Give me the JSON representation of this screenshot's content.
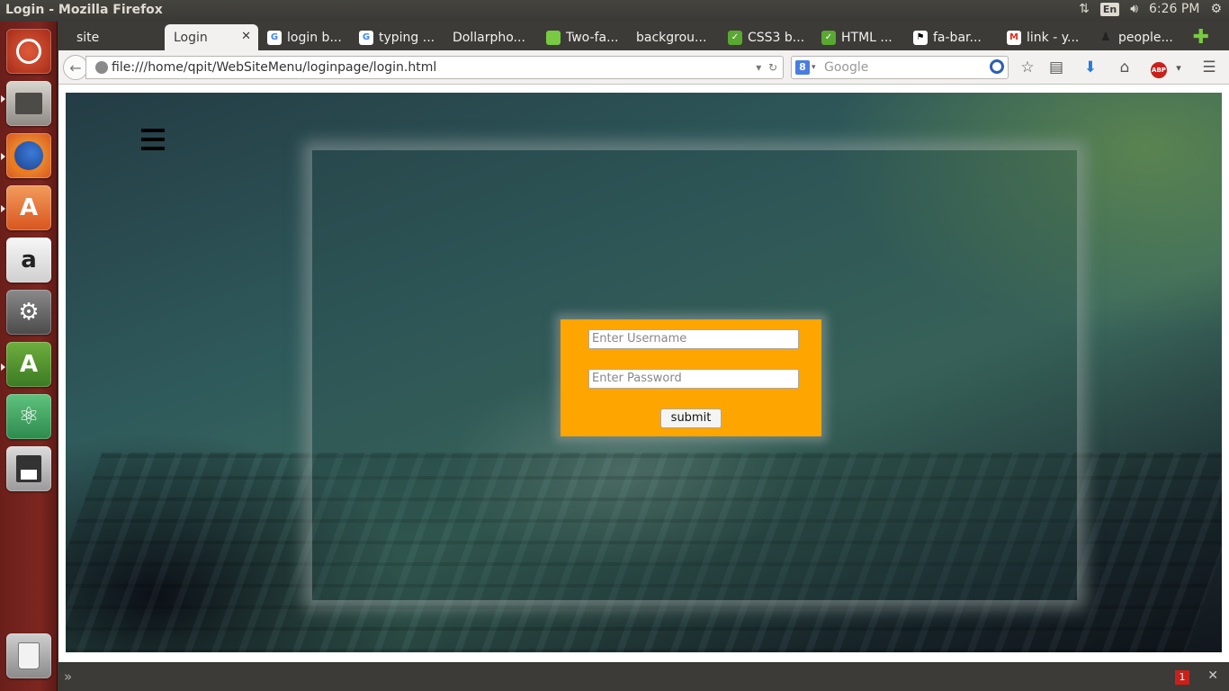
{
  "window": {
    "title": "Login - Mozilla Firefox"
  },
  "system": {
    "keyboard_layout": "En",
    "time": "6:26 PM"
  },
  "tabs": [
    {
      "label": "site",
      "icon": "none"
    },
    {
      "label": "Login",
      "icon": "none",
      "active": true
    },
    {
      "label": "login b...",
      "icon": "google-icon"
    },
    {
      "label": "typing ...",
      "icon": "google-icon"
    },
    {
      "label": "Dollarpho...",
      "icon": "none"
    },
    {
      "label": "Two-fa...",
      "icon": "green-page-icon"
    },
    {
      "label": "backgrou...",
      "icon": "none"
    },
    {
      "label": "CSS3 b...",
      "icon": "green-chart-icon"
    },
    {
      "label": "HTML ...",
      "icon": "green-chart-icon"
    },
    {
      "label": "fa-bar...",
      "icon": "flag-icon"
    },
    {
      "label": "link - y...",
      "icon": "gmail-icon"
    },
    {
      "label": "people...",
      "icon": "people-icon"
    }
  ],
  "nav": {
    "url": "file:///home/qpit/WebSiteMenu/loginpage/login.html",
    "search_placeholder": "Google"
  },
  "login": {
    "username_placeholder": "Enter Username",
    "password_placeholder": "Enter Password",
    "submit_label": "submit"
  },
  "bottom": {
    "badge_count": "1"
  },
  "colors": {
    "accent": "#ffa500",
    "launcher": "#7d2620",
    "chrome": "#3c3b37"
  }
}
